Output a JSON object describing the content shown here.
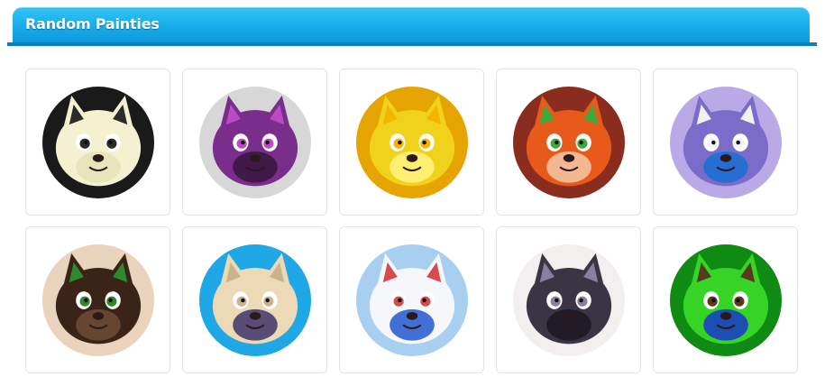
{
  "header": {
    "title": "Random Painties"
  },
  "colors": {
    "header_top": "#33c4f5",
    "header_bottom": "#0f97d9",
    "header_underline": "#0b7fbf",
    "card_border": "#e3e3e3"
  },
  "painties": [
    {
      "icon": "skull-fox-avatar",
      "palette": [
        "#f4f1d0",
        "#1a1a1a",
        "#e8e3b8",
        "#2b2b2b"
      ]
    },
    {
      "icon": "purple-fox-avatar",
      "palette": [
        "#7a2e8c",
        "#d7d7d7",
        "#3a1740",
        "#b84cc2"
      ]
    },
    {
      "icon": "yellow-dragon-avatar",
      "palette": [
        "#f0d21c",
        "#e6a400",
        "#fff27a",
        "#f4b400"
      ]
    },
    {
      "icon": "orange-lion-avatar",
      "palette": [
        "#e85a1c",
        "#8a2c1e",
        "#f2c2a0",
        "#3fa83a"
      ]
    },
    {
      "icon": "purple-walrus-avatar",
      "palette": [
        "#7c6cc9",
        "#b9a9e6",
        "#1e6fd4",
        "#f2f2f2"
      ]
    },
    {
      "icon": "brown-hamster-avatar",
      "palette": [
        "#3a2418",
        "#e9d3bd",
        "#6b4a34",
        "#2f8a2e"
      ]
    },
    {
      "icon": "cream-dog-avatar",
      "palette": [
        "#ecd9b5",
        "#1fa7e6",
        "#4a3d6e",
        "#c9b38a"
      ]
    },
    {
      "icon": "white-blue-fox-avatar",
      "palette": [
        "#f5f7fb",
        "#a8cff0",
        "#2f5fd1",
        "#d94b4b"
      ]
    },
    {
      "icon": "skunk-dog-avatar",
      "palette": [
        "#3a3445",
        "#f2efee",
        "#1e1a22",
        "#8a7fa0"
      ]
    },
    {
      "icon": "green-antler-avatar",
      "palette": [
        "#35d427",
        "#0f8a12",
        "#1b3fc4",
        "#5a3a1e"
      ]
    }
  ]
}
